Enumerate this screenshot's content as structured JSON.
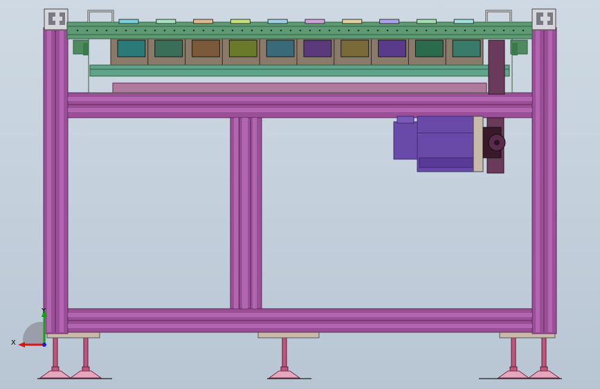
{
  "triad": {
    "x_label": "X",
    "y_label": "Y",
    "x_color": "#d01818",
    "y_color": "#18a018",
    "z_color": "#1a1ad0"
  },
  "colors": {
    "frame": "#9a4f97",
    "frame_dark": "#5b2a5a",
    "frame_light": "#c77ac4",
    "top_plate": "#5e9a73",
    "top_plate_dark": "#2f5e40",
    "rail": "#5fa48a",
    "motor": "#6a4aa8",
    "motor_dark": "#3d2a70",
    "foot": "#c2557a",
    "foot_pad": "#e4a7bc",
    "base_plate": "#c9b9a8",
    "background_top": "#ced9e3",
    "background_bottom": "#b8c5d3"
  },
  "module_colors": [
    "#2b7a78",
    "#3b6e58",
    "#7a5a3a",
    "#6a7a2a",
    "#3a6a7a",
    "#5a3a7a",
    "#7a6a3a",
    "#5a3a8a",
    "#2b6a4a",
    "#3a7a6a"
  ],
  "clip_colors": [
    "#7ad0e0",
    "#a8e0c0",
    "#e0b890",
    "#c8e080",
    "#a0d0e8",
    "#d0a0e0",
    "#e0d0a0",
    "#b0a0f0",
    "#a0e0b0",
    "#a0e0e0"
  ]
}
